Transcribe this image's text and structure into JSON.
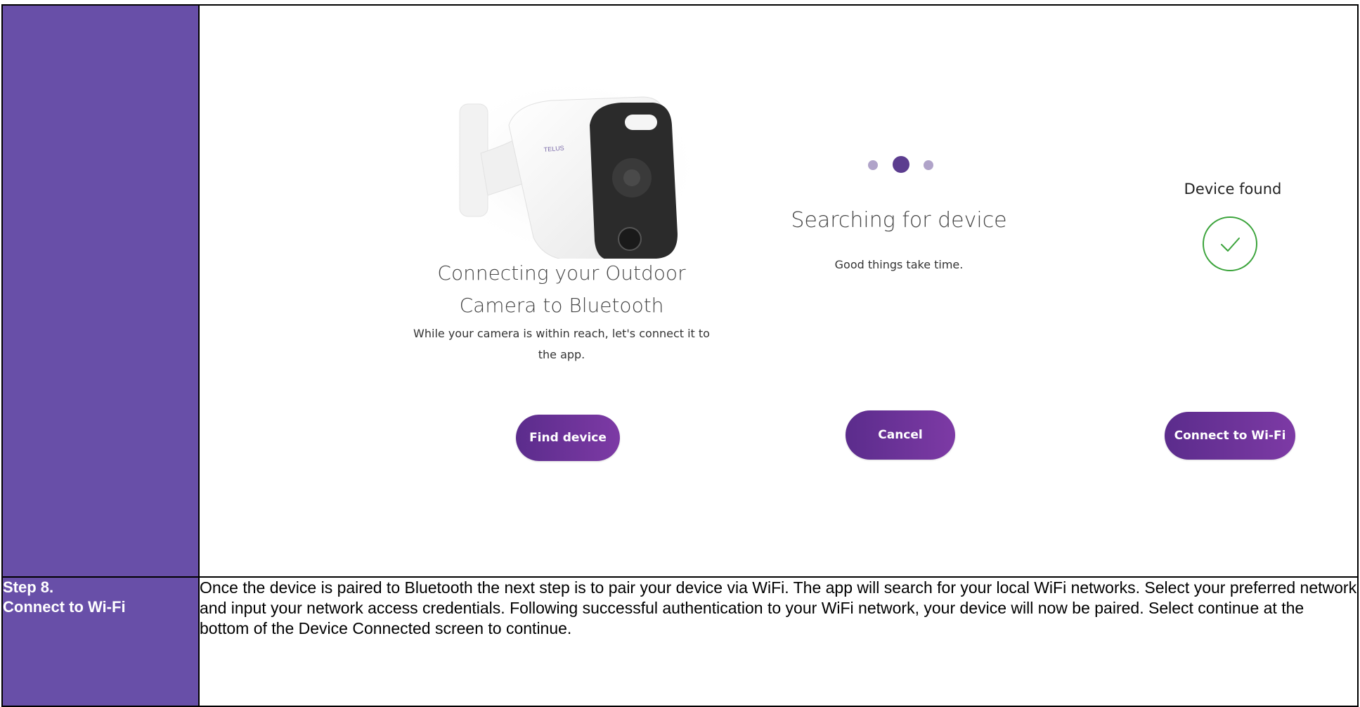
{
  "panels": {
    "bluetooth": {
      "title_line1": "Connecting your Outdoor",
      "title_line2": "Camera to Bluetooth",
      "text_line1": "While your camera is within reach, let's connect it to",
      "text_line2": "the app.",
      "button": "Find device",
      "camera_logo": "TELUS"
    },
    "searching": {
      "title": "Searching for device",
      "text": "Good things take time.",
      "button": "Cancel"
    },
    "found": {
      "title": "Device found",
      "button": "Connect to Wi-Fi"
    }
  },
  "step": {
    "label_line1": "Step 8.",
    "label_line2": "Connect to Wi-Fi",
    "description": "Once the device is paired to Bluetooth the next step is to pair your device via WiFi. The app will search for your local WiFi networks. Select your preferred network and input your network access credentials. Following successful authentication to your WiFi network, your device will now be paired. Select continue at the bottom of the Device Connected screen to continue."
  },
  "colors": {
    "sidebar": "#684fa8",
    "button": "#6a3399",
    "check": "#3aa33a",
    "dot_active": "#5c3d8f",
    "dot_inactive": "#b0a3c9"
  }
}
